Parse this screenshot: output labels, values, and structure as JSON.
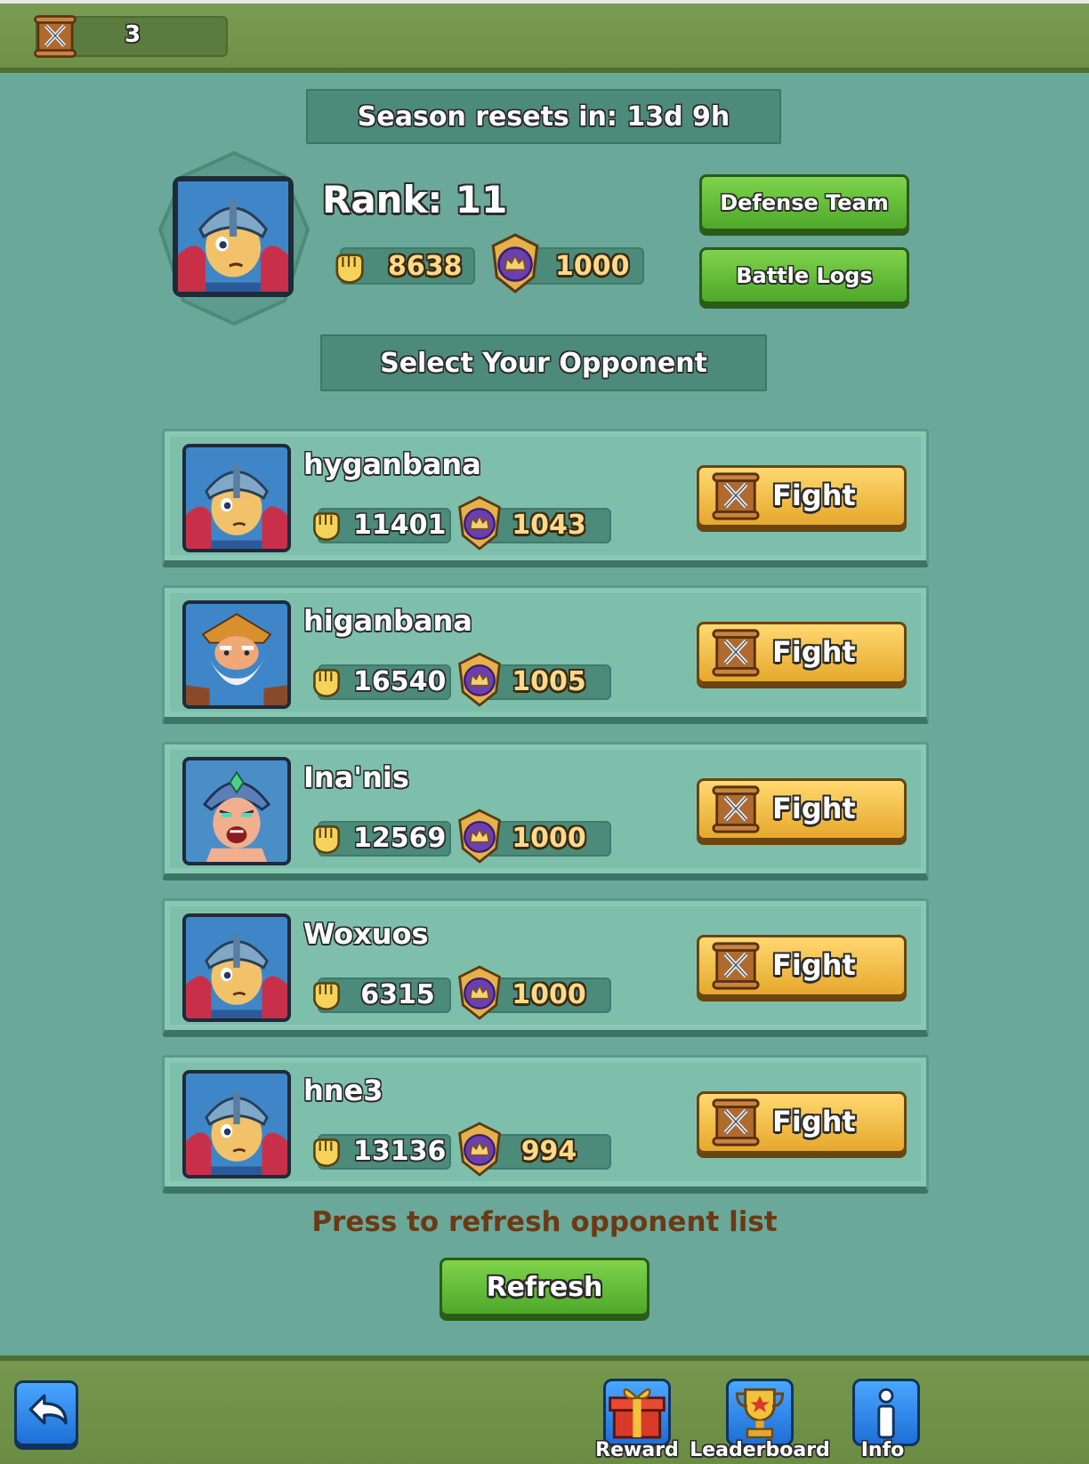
{
  "header": {
    "ticket_count": "3"
  },
  "season": {
    "label": "Season resets in: 13d 9h"
  },
  "player": {
    "rank_label": "Rank: 11",
    "power": "8638",
    "trophies": "1000",
    "defense_team_label": "Defense Team",
    "battle_logs_label": "Battle Logs"
  },
  "select_title": "Select Your Opponent",
  "opponents": [
    {
      "name": "hyganbana",
      "power": "11401",
      "trophies": "1043",
      "fight_label": "Fight",
      "avatar": "knight"
    },
    {
      "name": "higanbana",
      "power": "16540",
      "trophies": "1005",
      "fight_label": "Fight",
      "avatar": "dwarf"
    },
    {
      "name": "Ina'nis",
      "power": "12569",
      "trophies": "1000",
      "fight_label": "Fight",
      "avatar": "warrior"
    },
    {
      "name": "Woxuos",
      "power": "6315",
      "trophies": "1000",
      "fight_label": "Fight",
      "avatar": "knight"
    },
    {
      "name": "hne3",
      "power": "13136",
      "trophies": "994",
      "fight_label": "Fight",
      "avatar": "knight"
    }
  ],
  "refresh": {
    "hint": "Press to refresh opponent list",
    "button_label": "Refresh"
  },
  "bottom_nav": {
    "reward_label": "Reward",
    "leaderboard_label": "Leaderboard",
    "info_label": "Info"
  },
  "colors": {
    "background": "#6aa89a",
    "green_button": "#5cb834",
    "fight_button": "#f2be4a",
    "hint_text": "#6b3a14"
  },
  "icons": {
    "ticket": "crossed-swords-scroll-icon",
    "power": "fist-icon",
    "trophy": "crown-shield-icon",
    "back": "back-arrow-icon",
    "reward": "gift-icon",
    "leaderboard": "trophy-icon",
    "info": "info-icon"
  }
}
